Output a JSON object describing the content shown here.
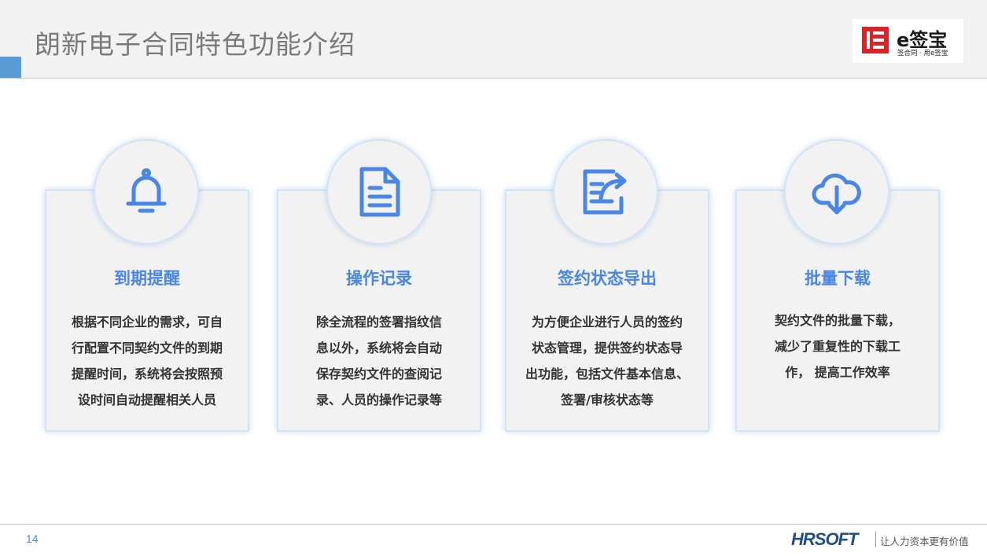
{
  "header": {
    "title": "朗新电子合同特色功能介绍",
    "logo_main": "e签宝",
    "logo_sub": "签合同 · 用e签宝"
  },
  "cards": [
    {
      "icon": "bell-icon",
      "title": "到期提醒",
      "body": [
        "根据不同企业的需求，可自",
        "行配置不同契约文件的到期",
        "提醒时间，系统将会按照预",
        "设时间自动提醒相关人员"
      ]
    },
    {
      "icon": "document-icon",
      "title": "操作记录",
      "body": [
        "除全流程的签署指纹信",
        "息以外，系统将会自动",
        "保存契约文件的查阅记",
        "录、人员的操作记录等"
      ]
    },
    {
      "icon": "export-icon",
      "title": "签约状态导出",
      "body": [
        "为方便企业进行人员的签约",
        "状态管理，提供签约状态导",
        "出功能，包括文件基本信息、",
        "签署/审核状态等"
      ]
    },
    {
      "icon": "cloud-download-icon",
      "title": "批量下载",
      "body": [
        "契约文件的批量下载，",
        "减少了重复性的下载工",
        "作， 提高工作效率"
      ]
    }
  ],
  "footer": {
    "page_number": "14",
    "brand": "HRSOFT",
    "slogan": "让人力资本更有价值"
  },
  "colors": {
    "accent": "#4a86e8",
    "header_square": "#5b9bd5",
    "logo_red": "#d7252a",
    "brand_blue": "#1f4e8c"
  }
}
